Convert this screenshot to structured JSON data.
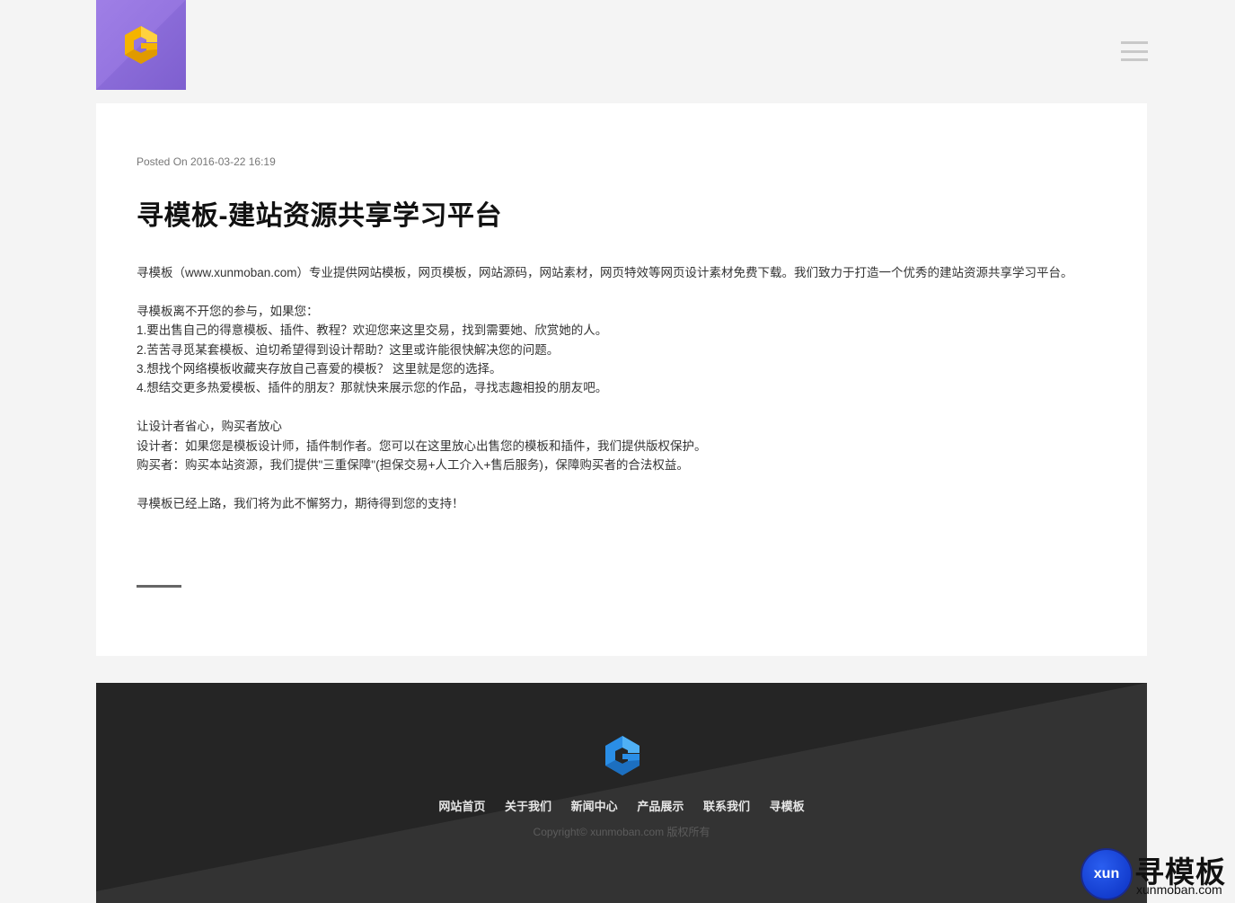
{
  "header": {
    "logo_icon": "g-logo-icon",
    "menu_icon": "hamburger-menu-icon"
  },
  "post": {
    "meta": "Posted On 2016-03-22 16:19",
    "title": "寻模板-建站资源共享学习平台",
    "paragraphs": [
      "寻模板（www.xunmoban.com）专业提供网站模板，网页模板，网站源码，网站素材，网页特效等网页设计素材免费下载。我们致力于打造一个优秀的建站资源共享学习平台。",
      "",
      "寻模板离不开您的参与，如果您：",
      "1.要出售自己的得意模板、插件、教程？欢迎您来这里交易，找到需要她、欣赏她的人。",
      "2.苦苦寻觅某套模板、迫切希望得到设计帮助？这里或许能很快解决您的问题。",
      "3.想找个网络模板收藏夹存放自己喜爱的模板？ 这里就是您的选择。",
      "4.想结交更多热爱模板、插件的朋友？那就快来展示您的作品，寻找志趣相投的朋友吧。",
      "",
      "让设计者省心，购买者放心",
      "设计者：如果您是模板设计师，插件制作者。您可以在这里放心出售您的模板和插件，我们提供版权保护。",
      "购买者：购买本站资源，我们提供\"三重保障\"(担保交易+人工介入+售后服务)，保障购买者的合法权益。",
      "",
      "寻模板已经上路，我们将为此不懈努力，期待得到您的支持！"
    ]
  },
  "footer": {
    "logo_icon": "g-logo-icon",
    "nav": [
      "网站首页",
      "关于我们",
      "新闻中心",
      "产品展示",
      "联系我们",
      "寻模板"
    ],
    "copyright": "Copyright© xunmoban.com 版权所有"
  },
  "watermark": {
    "badge": "xun",
    "text": "寻模板",
    "url": "xunmoban.com"
  },
  "colors": {
    "logo_bg": "#9575e0",
    "logo_yellow": "#f5b400",
    "footer_bg": "#252525",
    "footer_logo_blue": "#2a8ee6"
  }
}
